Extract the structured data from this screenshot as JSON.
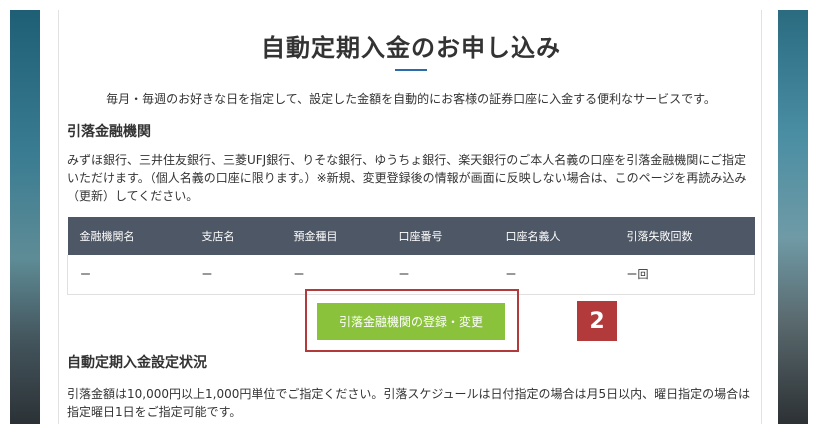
{
  "page": {
    "title": "自動定期入金のお申し込み",
    "intro": "毎月・毎週のお好きな日を指定して、設定した金額を自動的にお客様の証券口座に入金する便利なサービスです。"
  },
  "bank_section": {
    "heading": "引落金融機関",
    "description": "みずほ銀行、三井住友銀行、三菱UFJ銀行、りそな銀行、ゆうちょ銀行、楽天銀行のご本人名義の口座を引落金融機関にご指定いただけます。（個人名義の口座に限ります。）※新規、変更登録後の情報が画面に反映しない場合は、このページを再読み込み（更新）してください。",
    "table": {
      "headers": [
        "金融機関名",
        "支店名",
        "預金種目",
        "口座番号",
        "口座名義人",
        "引落失敗回数"
      ],
      "rows": [
        [
          "ー",
          "ー",
          "ー",
          "ー",
          "ー",
          "ー回"
        ]
      ]
    },
    "register_button": "引落金融機関の登録・変更",
    "step_badge": "2"
  },
  "settings_section": {
    "heading": "自動定期入金設定状況",
    "description": "引落金額は10,000円以上1,000円単位でご指定ください。引落スケジュールは日付指定の場合は月5日以内、曜日指定の場合は指定曜日1日をご指定可能です。"
  },
  "colors": {
    "accent_rule": "#2c6aa8",
    "table_header": "#4e5765",
    "button": "#8ac33b",
    "highlight": "#b23a3a"
  }
}
